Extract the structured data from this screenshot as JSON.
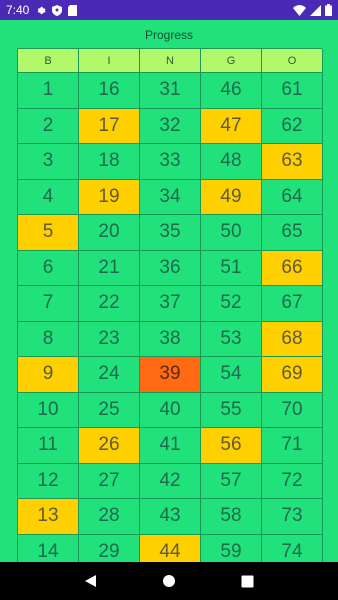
{
  "status_bar": {
    "time": "7:40",
    "colors": {
      "background": "#4a2ab5"
    },
    "left_icons": [
      "settings-gear-icon",
      "shield-icon",
      "sd-card-icon"
    ],
    "right_icons": [
      "wifi-icon",
      "cell-signal-icon",
      "battery-icon"
    ]
  },
  "screen": {
    "title": "Progress"
  },
  "board": {
    "columns": [
      "B",
      "I",
      "N",
      "G",
      "O"
    ],
    "rows": [
      [
        "1",
        "16",
        "31",
        "46",
        "61"
      ],
      [
        "2",
        "17",
        "32",
        "47",
        "62"
      ],
      [
        "3",
        "18",
        "33",
        "48",
        "63"
      ],
      [
        "4",
        "19",
        "34",
        "49",
        "64"
      ],
      [
        "5",
        "20",
        "35",
        "50",
        "65"
      ],
      [
        "6",
        "21",
        "36",
        "51",
        "66"
      ],
      [
        "7",
        "22",
        "37",
        "52",
        "67"
      ],
      [
        "8",
        "23",
        "38",
        "53",
        "68"
      ],
      [
        "9",
        "24",
        "39",
        "54",
        "69"
      ],
      [
        "10",
        "25",
        "40",
        "55",
        "70"
      ],
      [
        "11",
        "26",
        "41",
        "56",
        "71"
      ],
      [
        "12",
        "27",
        "42",
        "57",
        "72"
      ],
      [
        "13",
        "28",
        "43",
        "58",
        "73"
      ],
      [
        "14",
        "29",
        "44",
        "59",
        "74"
      ]
    ],
    "called_numbers": [
      "5",
      "9",
      "13",
      "17",
      "19",
      "26",
      "44",
      "47",
      "49",
      "56",
      "63",
      "66",
      "68",
      "69"
    ],
    "current_number": "39",
    "colors": {
      "background": "#20e17a",
      "header": "#b3f76a",
      "called": "#ffd000",
      "current": "#ff6a13",
      "grid_line": "#189a56"
    }
  },
  "nav_bar": {
    "buttons": [
      "back-triangle-icon",
      "home-circle-icon",
      "recents-square-icon"
    ]
  }
}
